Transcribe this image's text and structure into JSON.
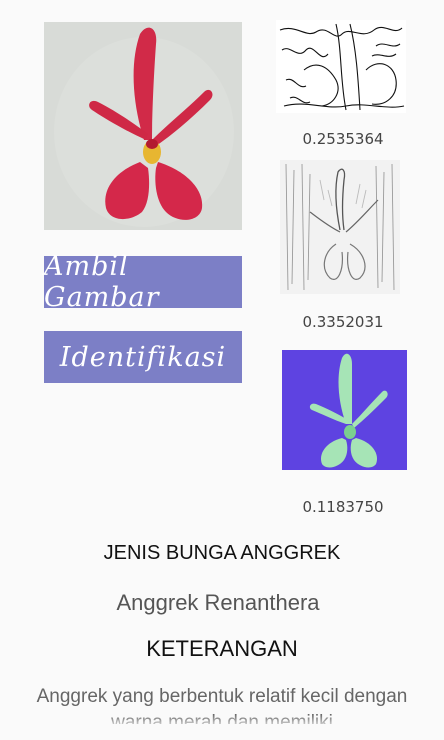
{
  "buttons": {
    "take_picture": "Ambil Gambar",
    "identify": "Identifikasi"
  },
  "features": [
    {
      "name": "edge-feature",
      "score": "0.2535364"
    },
    {
      "name": "texture-feature",
      "score": "0.3352031"
    },
    {
      "name": "color-feature",
      "score": "0.1183750"
    }
  ],
  "result": {
    "type_heading": "JENIS BUNGA ANGGREK",
    "type_value": "Anggrek Renanthera",
    "info_heading": "KETERANGAN",
    "description": "Anggrek yang berbentuk relatif kecil dengan warna merah dan memiliki"
  },
  "colors": {
    "button_bg": "#7c7fc6",
    "flower_red": "#d22845",
    "color_feature_bg": "#5a47e4",
    "color_feature_flower": "#a8e6b8"
  }
}
